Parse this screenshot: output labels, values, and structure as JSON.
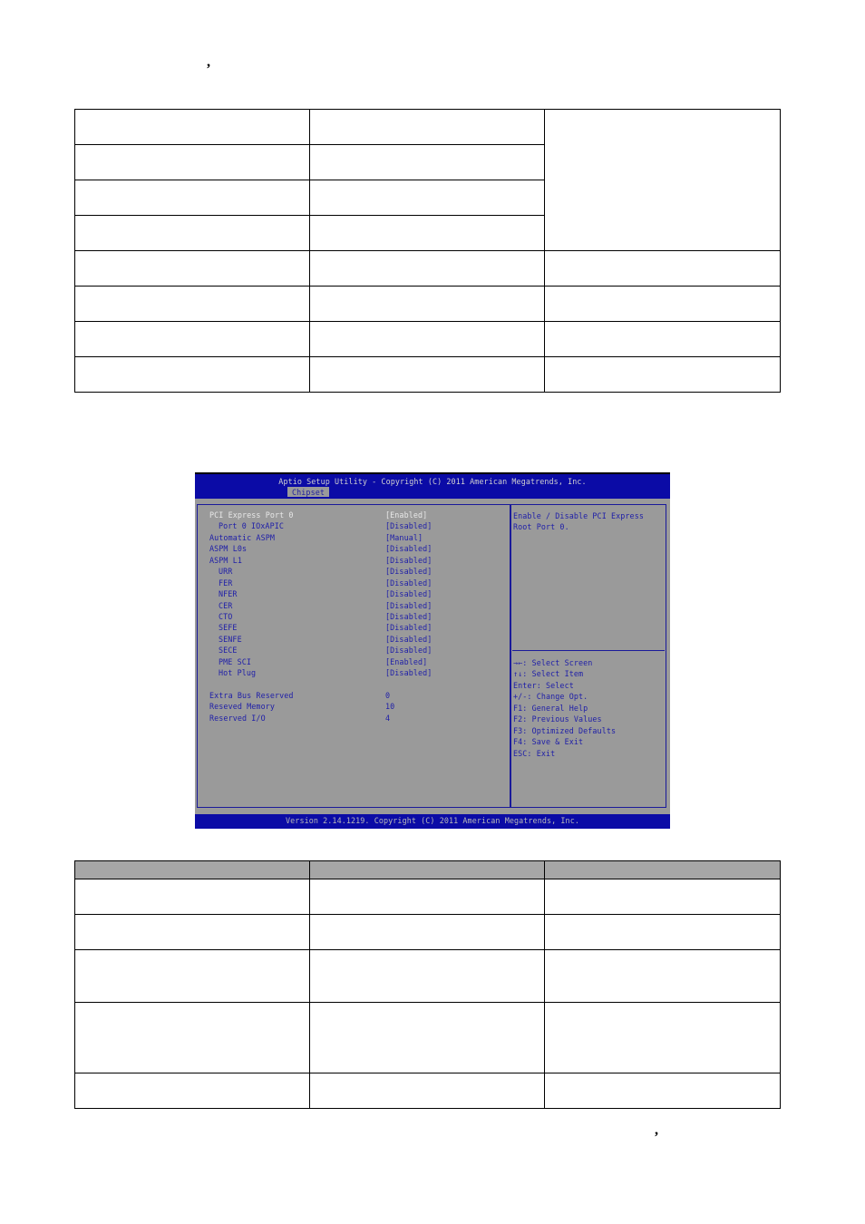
{
  "document": {
    "comma_top": ",",
    "comma_bottom": ","
  },
  "table_top": {
    "rows": [
      [
        "",
        "",
        ""
      ],
      [
        "",
        ""
      ],
      [
        "",
        ""
      ],
      [
        "",
        ""
      ],
      [
        "",
        "",
        ""
      ],
      [
        "",
        "",
        ""
      ],
      [
        "",
        "",
        ""
      ],
      [
        "",
        "",
        ""
      ]
    ]
  },
  "bios": {
    "title": "Aptio Setup Utility - Copyright (C) 2011 American Megatrends, Inc.",
    "active_tab": "Chipset",
    "items": [
      {
        "label": "PCI Express Port 0",
        "value": "[Enabled]",
        "indent": false,
        "selected": true
      },
      {
        "label": "Port 0 IOxAPIC",
        "value": "[Disabled]",
        "indent": true,
        "selected": false
      },
      {
        "label": "Automatic ASPM",
        "value": "[Manual]",
        "indent": false,
        "selected": false
      },
      {
        "label": "ASPM L0s",
        "value": "[Disabled]",
        "indent": false,
        "selected": false
      },
      {
        "label": "ASPM L1",
        "value": "[Disabled]",
        "indent": false,
        "selected": false
      },
      {
        "label": "URR",
        "value": "[Disabled]",
        "indent": true,
        "selected": false
      },
      {
        "label": "FER",
        "value": "[Disabled]",
        "indent": true,
        "selected": false
      },
      {
        "label": "NFER",
        "value": "[Disabled]",
        "indent": true,
        "selected": false
      },
      {
        "label": "CER",
        "value": "[Disabled]",
        "indent": true,
        "selected": false
      },
      {
        "label": "CTO",
        "value": "[Disabled]",
        "indent": true,
        "selected": false
      },
      {
        "label": "SEFE",
        "value": "[Disabled]",
        "indent": true,
        "selected": false
      },
      {
        "label": "SENFE",
        "value": "[Disabled]",
        "indent": true,
        "selected": false
      },
      {
        "label": "SECE",
        "value": "[Disabled]",
        "indent": true,
        "selected": false
      },
      {
        "label": "PME SCI",
        "value": "[Enabled]",
        "indent": true,
        "selected": false
      },
      {
        "label": "Hot Plug",
        "value": "[Disabled]",
        "indent": true,
        "selected": false
      }
    ],
    "numeric_items": [
      {
        "label": "Extra Bus Reserved",
        "value": "0"
      },
      {
        "label": "Reseved Memory",
        "value": "10"
      },
      {
        "label": "Reserved I/O",
        "value": "4"
      }
    ],
    "help_text": [
      "Enable / Disable PCI Express",
      "Root Port 0."
    ],
    "key_help": [
      "→←: Select Screen",
      "↑↓: Select Item",
      "Enter: Select",
      "+/-: Change Opt.",
      "F1: General Help",
      "F2: Previous Values",
      "F3: Optimized Defaults",
      "F4: Save & Exit",
      "ESC: Exit"
    ],
    "footer": "Version 2.14.1219. Copyright (C) 2011 American Megatrends, Inc.",
    "colors": {
      "bar_blue": "#0b0ba6",
      "panel_gray": "#9a9a9a",
      "text_blue": "#1e1ea8",
      "text_white": "#e8e8e8"
    }
  },
  "table_bottom": {
    "header": [
      "",
      "",
      ""
    ],
    "rows": [
      [
        "",
        "",
        ""
      ],
      [
        "",
        "",
        ""
      ],
      [
        "",
        "",
        ""
      ],
      [
        "",
        "",
        ""
      ],
      [
        "",
        "",
        ""
      ]
    ]
  }
}
